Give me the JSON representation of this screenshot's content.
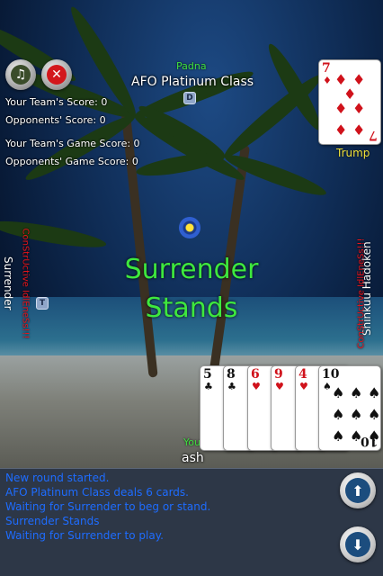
{
  "top_player": {
    "name": "Padna",
    "team": "AFO Platinum Class",
    "dealer_badge": "D"
  },
  "scores": {
    "team_score": "Your Team's Score: 0",
    "opp_score": "Opponents' Score: 0",
    "team_game_score": "Your Team's Game Score: 0",
    "opp_game_score": "Opponents' Game Score: 0"
  },
  "trump": {
    "label": "Trump",
    "rank": "7",
    "suit": "♦",
    "suit_color": "#d0121b"
  },
  "left_player": {
    "name": "Surrender",
    "status": "ConStrUctive IdlEneSs!!!",
    "badge": "T"
  },
  "right_player": {
    "name": "Shinkuu Hadoken",
    "status": "ConStrUctive IdlEneSs!!!"
  },
  "center": {
    "line1": "Surrender",
    "line2": "Stands"
  },
  "bottom_player": {
    "label_partial": "You",
    "name": "ash"
  },
  "hand": [
    {
      "rank": "5",
      "suit": "♣",
      "color": "black"
    },
    {
      "rank": "8",
      "suit": "♣",
      "color": "black"
    },
    {
      "rank": "6",
      "suit": "♥",
      "color": "red"
    },
    {
      "rank": "9",
      "suit": "♥",
      "color": "red"
    },
    {
      "rank": "4",
      "suit": "♥",
      "color": "red"
    },
    {
      "rank": "10",
      "suit": "♠",
      "color": "black"
    }
  ],
  "log": [
    "New round started.",
    "AFO Platinum Class deals 6 cards.",
    "Waiting for Surrender to beg or stand.",
    "Surrender Stands",
    "Waiting for Surrender to play."
  ],
  "icons": {
    "music": "music-note-icon",
    "close": "close-icon",
    "turn": "turn-indicator-icon",
    "up": "arrow-up-icon",
    "down": "arrow-down-icon"
  },
  "colors": {
    "accent_green": "#3ee83e",
    "status_red": "#e8141b",
    "log_blue": "#1e6cff"
  }
}
